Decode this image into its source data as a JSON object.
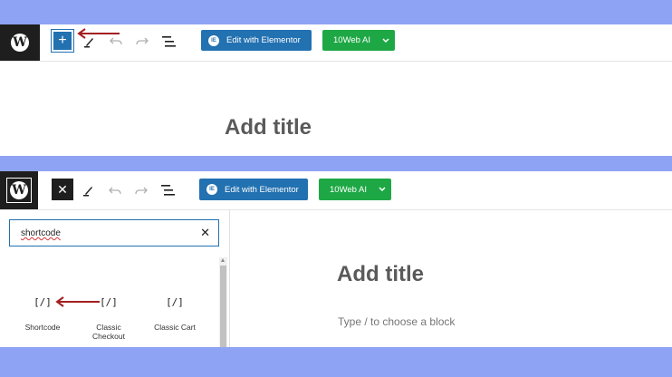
{
  "top_editor": {
    "elementor_label": "Edit with Elementor",
    "elementor_badge": "IE",
    "ai_label": "10Web AI",
    "title_placeholder": "Add title"
  },
  "bottom_editor": {
    "elementor_label": "Edit with Elementor",
    "elementor_badge": "IE",
    "ai_label": "10Web AI",
    "search_value": "shortcode",
    "title_placeholder": "Add title",
    "block_placeholder": "Type / to choose a block",
    "results": [
      {
        "icon": "[/]",
        "label": "Shortcode"
      },
      {
        "icon": "[/]",
        "label": "Classic Checkout"
      },
      {
        "icon": "[/]",
        "label": "Classic Cart"
      }
    ]
  },
  "colors": {
    "background": "#8fa3f4",
    "elementor": "#2271b1",
    "ai": "#1ea845",
    "arrow": "#a31f1f"
  }
}
